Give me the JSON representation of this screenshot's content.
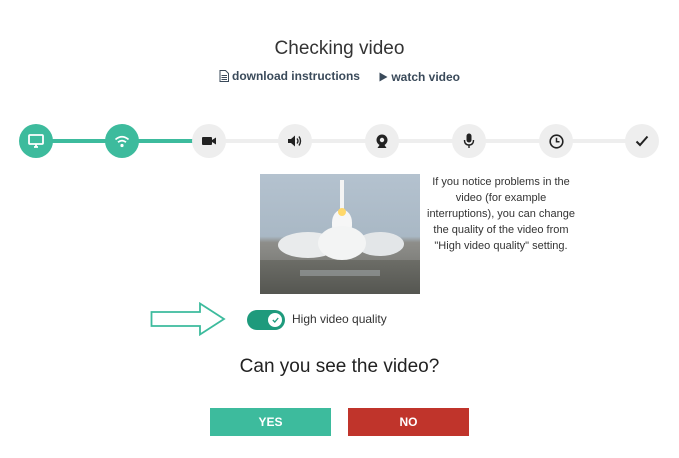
{
  "header": {
    "title": "Checking video",
    "download_label": "download instructions",
    "watch_label": "watch video"
  },
  "steps": [
    {
      "icon": "monitor-icon",
      "status": "done"
    },
    {
      "icon": "wifi-icon",
      "status": "done"
    },
    {
      "icon": "video-camera-icon",
      "status": "current"
    },
    {
      "icon": "speaker-icon",
      "status": "pending"
    },
    {
      "icon": "webcam-icon",
      "status": "pending"
    },
    {
      "icon": "microphone-icon",
      "status": "pending"
    },
    {
      "icon": "clock-icon",
      "status": "pending"
    },
    {
      "icon": "checkmark-icon",
      "status": "pending"
    }
  ],
  "info_text": "If you notice problems in the video (for example interruptions), you can change the quality of the video from \"High video quality\" setting.",
  "toggle": {
    "label": "High video quality",
    "on": true
  },
  "question": "Can you see the video?",
  "buttons": {
    "yes": "YES",
    "no": "NO"
  },
  "colors": {
    "accent": "#3dbb9d",
    "toggle": "#1e9a7c",
    "danger": "#c0342b",
    "inactive": "#eeeeee"
  }
}
